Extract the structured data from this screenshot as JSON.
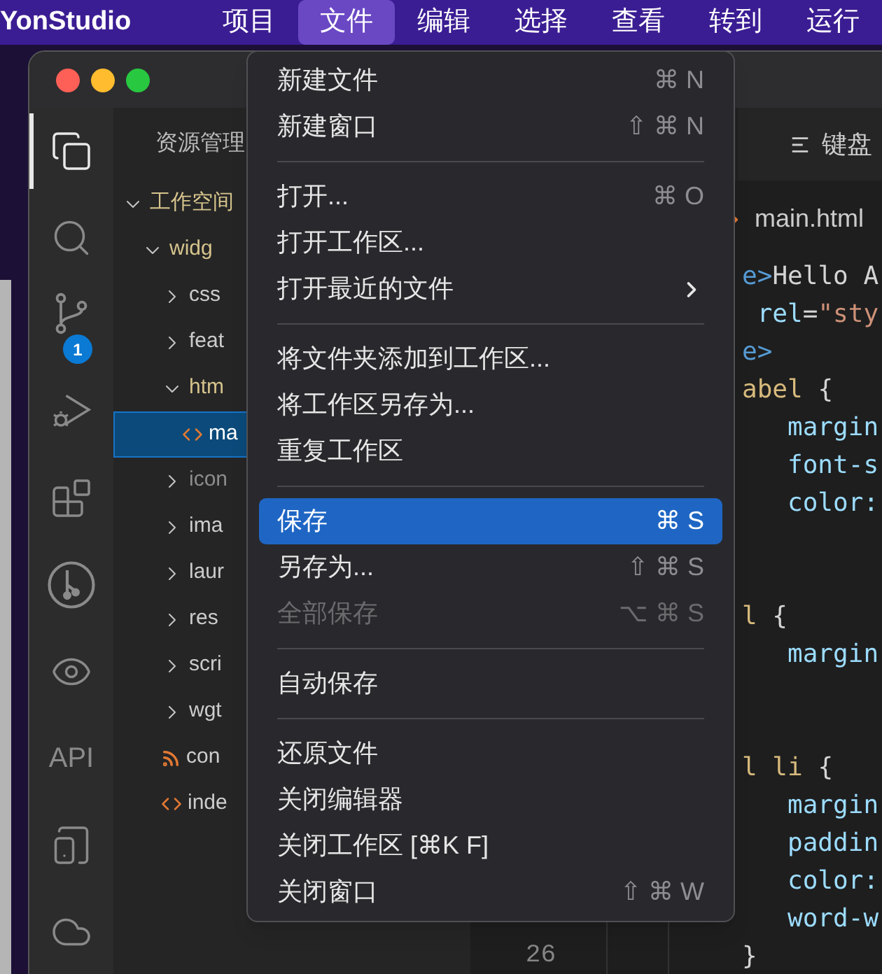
{
  "menu_bar": {
    "app_name": "YonStudio",
    "items": [
      {
        "label": "项目",
        "selected": false
      },
      {
        "label": "文件",
        "selected": true
      },
      {
        "label": "编辑",
        "selected": false
      },
      {
        "label": "选择",
        "selected": false
      },
      {
        "label": "查看",
        "selected": false
      },
      {
        "label": "转到",
        "selected": false
      },
      {
        "label": "运行",
        "selected": false
      }
    ]
  },
  "activity_bar": {
    "items": [
      {
        "kind": "files",
        "selected": true
      },
      {
        "kind": "search",
        "selected": false
      },
      {
        "kind": "source-control",
        "selected": false,
        "badge": "1"
      },
      {
        "kind": "debug",
        "selected": false
      },
      {
        "kind": "extensions",
        "selected": false
      },
      {
        "kind": "git-graph",
        "selected": false
      },
      {
        "kind": "preview",
        "selected": false
      },
      {
        "kind": "text",
        "label": "API",
        "selected": false
      },
      {
        "kind": "device",
        "selected": false
      },
      {
        "kind": "cloud",
        "selected": false
      }
    ]
  },
  "explorer": {
    "title": "资源管理",
    "tree": [
      {
        "label": "工作空间",
        "kind": "folder",
        "expanded": true,
        "selected": false,
        "dimmed": false,
        "children": [
          {
            "label": "widg",
            "kind": "folder",
            "expanded": true,
            "selected": false,
            "dimmed": false,
            "children": [
              {
                "label": "css",
                "kind": "folder",
                "expanded": false,
                "selected": false,
                "dimmed": false
              },
              {
                "label": "feat",
                "kind": "folder",
                "expanded": false,
                "selected": false,
                "dimmed": false
              },
              {
                "label": "htm",
                "kind": "folder",
                "expanded": true,
                "selected": false,
                "dimmed": false,
                "children": [
                  {
                    "label": "ma",
                    "kind": "html-file",
                    "selected": true,
                    "dimmed": false
                  }
                ]
              },
              {
                "label": "icon",
                "kind": "folder",
                "expanded": false,
                "selected": false,
                "dimmed": true
              },
              {
                "label": "ima",
                "kind": "folder",
                "expanded": false,
                "selected": false,
                "dimmed": false
              },
              {
                "label": "laur",
                "kind": "folder",
                "expanded": false,
                "selected": false,
                "dimmed": false
              },
              {
                "label": "res",
                "kind": "folder",
                "expanded": false,
                "selected": false,
                "dimmed": false
              },
              {
                "label": "scri",
                "kind": "folder",
                "expanded": false,
                "selected": false,
                "dimmed": false
              },
              {
                "label": "wgt",
                "kind": "folder",
                "expanded": false,
                "selected": false,
                "dimmed": false
              },
              {
                "label": "con",
                "kind": "feed-file",
                "selected": false,
                "dimmed": false
              },
              {
                "label": "inde",
                "kind": "html-file",
                "selected": false,
                "dimmed": false
              }
            ]
          }
        ]
      }
    ]
  },
  "editor": {
    "tab": {
      "label": "键盘"
    },
    "breadcrumb": "main.html",
    "lines": [
      {
        "kind": "code",
        "tokens": [
          {
            "text": "e>",
            "kind": "tag"
          },
          {
            "text": "Hello A",
            "kind": "text"
          }
        ]
      },
      {
        "kind": "code",
        "tokens": [
          {
            "text": " rel",
            "kind": "attr"
          },
          {
            "text": "=",
            "kind": "text"
          },
          {
            "text": "\"sty",
            "kind": "string"
          }
        ]
      },
      {
        "kind": "code",
        "tokens": [
          {
            "text": "e>",
            "kind": "tag"
          }
        ]
      },
      {
        "kind": "code",
        "tokens": [
          {
            "text": "abel",
            "kind": "selector"
          },
          {
            "text": " {",
            "kind": "text"
          }
        ]
      },
      {
        "kind": "code",
        "tokens": [
          {
            "text": "   margin",
            "kind": "property"
          }
        ]
      },
      {
        "kind": "code",
        "tokens": [
          {
            "text": "   font-s",
            "kind": "property"
          }
        ]
      },
      {
        "kind": "code",
        "tokens": [
          {
            "text": "   color:",
            "kind": "property"
          }
        ]
      },
      {
        "kind": "blank"
      },
      {
        "kind": "blank"
      },
      {
        "kind": "code",
        "tokens": [
          {
            "text": "l",
            "kind": "selector"
          },
          {
            "text": " {",
            "kind": "text"
          }
        ]
      },
      {
        "kind": "code",
        "tokens": [
          {
            "text": "   margin",
            "kind": "property"
          }
        ]
      },
      {
        "kind": "blank"
      },
      {
        "kind": "blank"
      },
      {
        "kind": "code",
        "tokens": [
          {
            "text": "l li",
            "kind": "selector"
          },
          {
            "text": " {",
            "kind": "text"
          }
        ]
      },
      {
        "kind": "code",
        "tokens": [
          {
            "text": "   margin",
            "kind": "property"
          }
        ]
      },
      {
        "kind": "code",
        "tokens": [
          {
            "text": "   paddin",
            "kind": "property"
          }
        ]
      },
      {
        "kind": "code",
        "tokens": [
          {
            "text": "   color:",
            "kind": "property"
          }
        ]
      },
      {
        "kind": "code",
        "tokens": [
          {
            "text": "   word-w",
            "kind": "property"
          }
        ]
      },
      {
        "kind": "code",
        "number": "26",
        "tokens": [
          {
            "text": "}",
            "kind": "text"
          }
        ]
      }
    ]
  },
  "file_menu": {
    "items": [
      {
        "kind": "item",
        "label": "新建文件",
        "shortcut": "⌘ N",
        "selected": false,
        "disabled": false
      },
      {
        "kind": "item",
        "label": "新建窗口",
        "shortcut": "⇧ ⌘ N",
        "selected": false,
        "disabled": false
      },
      {
        "kind": "separator"
      },
      {
        "kind": "item",
        "label": "打开...",
        "shortcut": "⌘ O",
        "selected": false,
        "disabled": false
      },
      {
        "kind": "item",
        "label": "打开工作区...",
        "selected": false,
        "disabled": false
      },
      {
        "kind": "submenu",
        "label": "打开最近的文件",
        "selected": false,
        "disabled": false
      },
      {
        "kind": "separator"
      },
      {
        "kind": "item",
        "label": "将文件夹添加到工作区...",
        "selected": false,
        "disabled": false
      },
      {
        "kind": "item",
        "label": "将工作区另存为...",
        "selected": false,
        "disabled": false
      },
      {
        "kind": "item",
        "label": "重复工作区",
        "selected": false,
        "disabled": false
      },
      {
        "kind": "separator"
      },
      {
        "kind": "item",
        "label": "保存",
        "shortcut": "⌘ S",
        "selected": true,
        "disabled": false
      },
      {
        "kind": "item",
        "label": "另存为...",
        "shortcut": "⇧ ⌘ S",
        "selected": false,
        "disabled": false
      },
      {
        "kind": "item",
        "label": "全部保存",
        "shortcut": "⌥ ⌘ S",
        "selected": false,
        "disabled": true
      },
      {
        "kind": "separator"
      },
      {
        "kind": "item",
        "label": "自动保存",
        "selected": false,
        "disabled": false
      },
      {
        "kind": "separator"
      },
      {
        "kind": "item",
        "label": "还原文件",
        "selected": false,
        "disabled": false
      },
      {
        "kind": "item",
        "label": "关闭编辑器",
        "selected": false,
        "disabled": false
      },
      {
        "kind": "item",
        "label": "关闭工作区 [⌘K F]",
        "selected": false,
        "disabled": false
      },
      {
        "kind": "item",
        "label": "关闭窗口",
        "shortcut": "⇧ ⌘ W",
        "selected": false,
        "disabled": false
      }
    ]
  }
}
